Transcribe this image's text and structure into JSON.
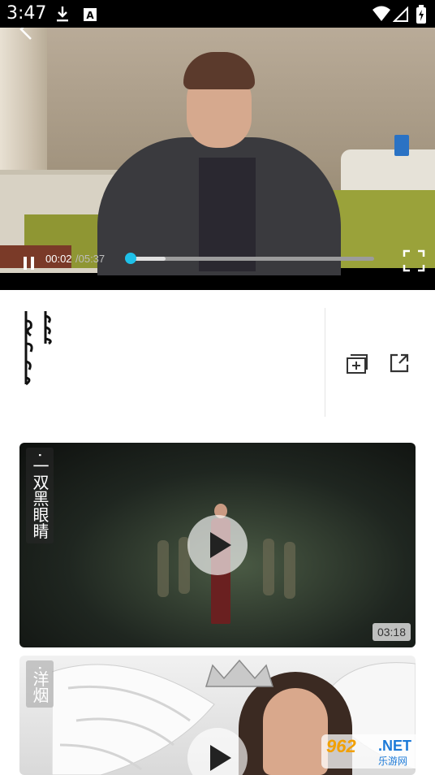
{
  "status_bar": {
    "time": "3:47",
    "icons": [
      "download-icon",
      "text-a-icon",
      "wifi-icon",
      "signal-icon",
      "battery-icon"
    ]
  },
  "player": {
    "current_time": "00:02",
    "total_time": "/05:37",
    "progress_fraction": 0.006,
    "buffered_fraction": 0.15,
    "accent_color": "#1ec0e8"
  },
  "info": {
    "title_script": "mongolian-vertical-title",
    "actions": [
      "add-to-collection-icon",
      "share-icon"
    ]
  },
  "videos": [
    {
      "title": "·一双黑眼睛",
      "duration": "03:18"
    },
    {
      "title": "·洋烟",
      "duration": ""
    }
  ],
  "watermark": {
    "number": "962",
    "domain": ".NET",
    "subtitle": "乐游网"
  }
}
